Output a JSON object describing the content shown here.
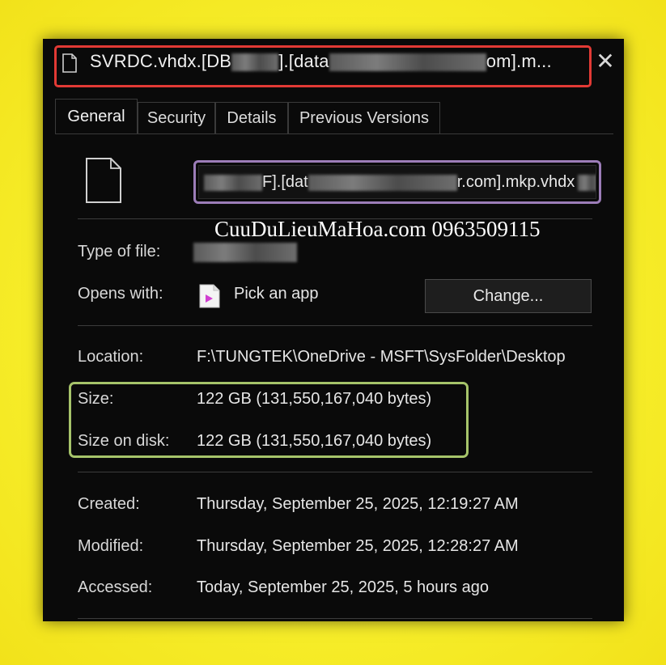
{
  "window": {
    "title_prefix": "SVRDC.vhdx.[DB",
    "title_mid": "].[data",
    "title_suffix": "om].m...",
    "close_label": "✕"
  },
  "tabs": [
    {
      "label": "General"
    },
    {
      "label": "Security"
    },
    {
      "label": "Details"
    },
    {
      "label": "Previous Versions"
    }
  ],
  "file": {
    "name_prefix": "F].[dat",
    "name_suffix": "r.com].mkp.vhdx"
  },
  "watermark": "CuuDuLieuMaHoa.com 0963509115",
  "props": {
    "type_label": "Type of file:",
    "opens_label": "Opens with:",
    "opens_value": "Pick an app",
    "change_button": "Change...",
    "location_label": "Location:",
    "location_value": "F:\\TUNGTEK\\OneDrive - MSFT\\SysFolder\\Desktop",
    "size_label": "Size:",
    "size_value": "122 GB (131,550,167,040 bytes)",
    "size_on_disk_label": "Size on disk:",
    "size_on_disk_value": "122 GB (131,550,167,040 bytes)",
    "created_label": "Created:",
    "created_value": "Thursday, September 25, 2025, 12:19:27 AM",
    "modified_label": "Modified:",
    "modified_value": "Thursday, September 25, 2025, 12:28:27 AM",
    "accessed_label": "Accessed:",
    "accessed_value": "Today, September 25, 2025, 5 hours ago"
  },
  "colors": {
    "background": "#f7ef2c",
    "title_highlight": "#e23a35",
    "name_highlight": "#9c7db8",
    "size_highlight": "#a6c46a",
    "app_icon_accent": "#d03fd0"
  },
  "icons": [
    "file-icon",
    "close-icon",
    "app-icon"
  ]
}
